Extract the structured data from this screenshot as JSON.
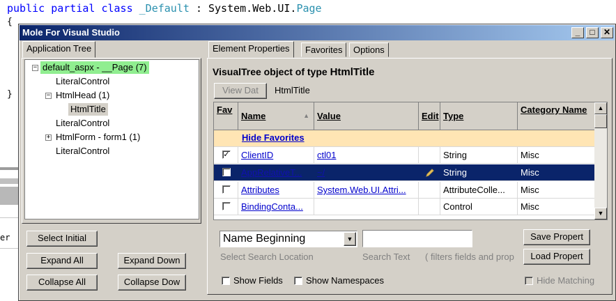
{
  "editor": {
    "code_tokens": [
      "public",
      "partial",
      "class",
      "_Default",
      ":",
      "System.Web.UI.",
      "Page"
    ],
    "brace_open": "{",
    "brace_close": "}",
    "left_strip_text": "er"
  },
  "window": {
    "title": "Mole For Visual Studio",
    "controls": {
      "minimize": "_",
      "maximize": "□",
      "close": "✕"
    }
  },
  "left_panel": {
    "tab": "Application Tree",
    "tree": [
      {
        "label": "default_aspx - __Page (7)",
        "expander": "−",
        "highlight": "green"
      },
      {
        "label": "LiteralControl"
      },
      {
        "label": "HtmlHead (1)",
        "expander": "−"
      },
      {
        "label": "HtmlTitle",
        "highlight": "grey"
      },
      {
        "label": "LiteralControl"
      },
      {
        "label": "HtmlForm - form1 (1)",
        "expander": "+"
      },
      {
        "label": "LiteralControl"
      }
    ],
    "buttons": {
      "select_initial": "Select Initial",
      "expand_all": "Expand All",
      "expand_down": "Expand Down",
      "collapse_all": "Collapse All",
      "collapse_down": "Collapse Dow"
    }
  },
  "right_panel": {
    "tabs": [
      "Element Properties",
      "Favorites",
      "Options"
    ],
    "heading_prefix": "VisualTree object of type ",
    "heading_type": "HtmlTitle",
    "view_data_button": "View Dat",
    "view_data_caption": "HtmlTitle",
    "grid": {
      "columns": [
        "Fav",
        "Name",
        "Value",
        "Edit",
        "Type",
        "Category Name"
      ],
      "favorites_toggle": "Hide Favorites",
      "rows": [
        {
          "fav": true,
          "name": "ClientID",
          "value": "ctl01",
          "edit": "",
          "type": "String",
          "category": "Misc",
          "selected": false
        },
        {
          "fav": false,
          "name": "AppRelativeT...",
          "value": "~/",
          "edit": "pencil",
          "type": "String",
          "category": "Misc",
          "selected": true
        },
        {
          "fav": false,
          "name": "Attributes",
          "value": "System.Web.UI.Attri...",
          "edit": "",
          "type": "AttributeColle...",
          "category": "Misc",
          "selected": false
        },
        {
          "fav": false,
          "name": "BindingConta...",
          "value": "",
          "edit": "",
          "type": "Control",
          "category": "Misc",
          "selected": false
        }
      ]
    },
    "search": {
      "location_value": "Name Beginning",
      "location_label": "Select Search Location",
      "text_value": "",
      "text_label": "Search Text",
      "filter_note": "( filters fields and prop"
    },
    "buttons": {
      "save": "Save Propert",
      "load": "Load Propert"
    },
    "options": {
      "show_fields": {
        "label": "Show Fields",
        "checked": false
      },
      "show_namespaces": {
        "label": "Show Namespaces",
        "checked": false
      },
      "hide_matching": {
        "label": "Hide Matching",
        "checked": false
      }
    }
  },
  "colors": {
    "title_start": "#0a246a",
    "title_end": "#a6caf0",
    "tree_highlight_green": "#90ee90",
    "tree_highlight_grey": "#d4d0c8",
    "selected_row": "#0a246a",
    "favorites_band": "#ffe5b4",
    "link": "#0000cc"
  }
}
